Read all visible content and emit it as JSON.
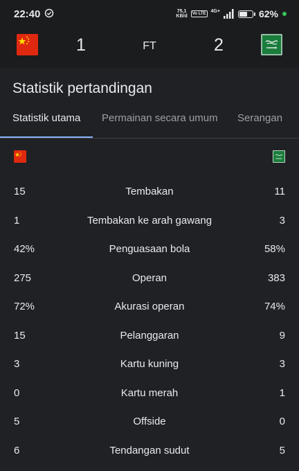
{
  "status_bar": {
    "time": "22:40",
    "net_speed_value": "75,1",
    "net_speed_unit": "KB/d",
    "volte": "Vo LTE",
    "network_type": "4G+",
    "battery_percent": "62%",
    "battery_level": 0.62
  },
  "match": {
    "home": {
      "flag": "china-flag",
      "score": "1"
    },
    "away": {
      "flag": "saudi-arabia-flag",
      "score": "2"
    },
    "status": "FT"
  },
  "section_title": "Statistik pertandingan",
  "tabs": [
    {
      "label": "Statistik utama",
      "active": true
    },
    {
      "label": "Permainan secara umum",
      "active": false
    },
    {
      "label": "Serangan",
      "active": false
    }
  ],
  "stats": [
    {
      "home": "15",
      "label": "Tembakan",
      "away": "11"
    },
    {
      "home": "1",
      "label": "Tembakan ke arah gawang",
      "away": "3"
    },
    {
      "home": "42%",
      "label": "Penguasaan bola",
      "away": "58%"
    },
    {
      "home": "275",
      "label": "Operan",
      "away": "383"
    },
    {
      "home": "72%",
      "label": "Akurasi operan",
      "away": "74%"
    },
    {
      "home": "15",
      "label": "Pelanggaran",
      "away": "9"
    },
    {
      "home": "3",
      "label": "Kartu kuning",
      "away": "3"
    },
    {
      "home": "0",
      "label": "Kartu merah",
      "away": "1"
    },
    {
      "home": "5",
      "label": "Offside",
      "away": "0"
    },
    {
      "home": "6",
      "label": "Tendangan sudut",
      "away": "5"
    }
  ],
  "colors": {
    "background": "#202124",
    "header": "#1b1c1e",
    "accent": "#8ab4f8",
    "china_red": "#de2910",
    "china_yellow": "#ffde00",
    "saudi_green": "#1b7d3c"
  }
}
